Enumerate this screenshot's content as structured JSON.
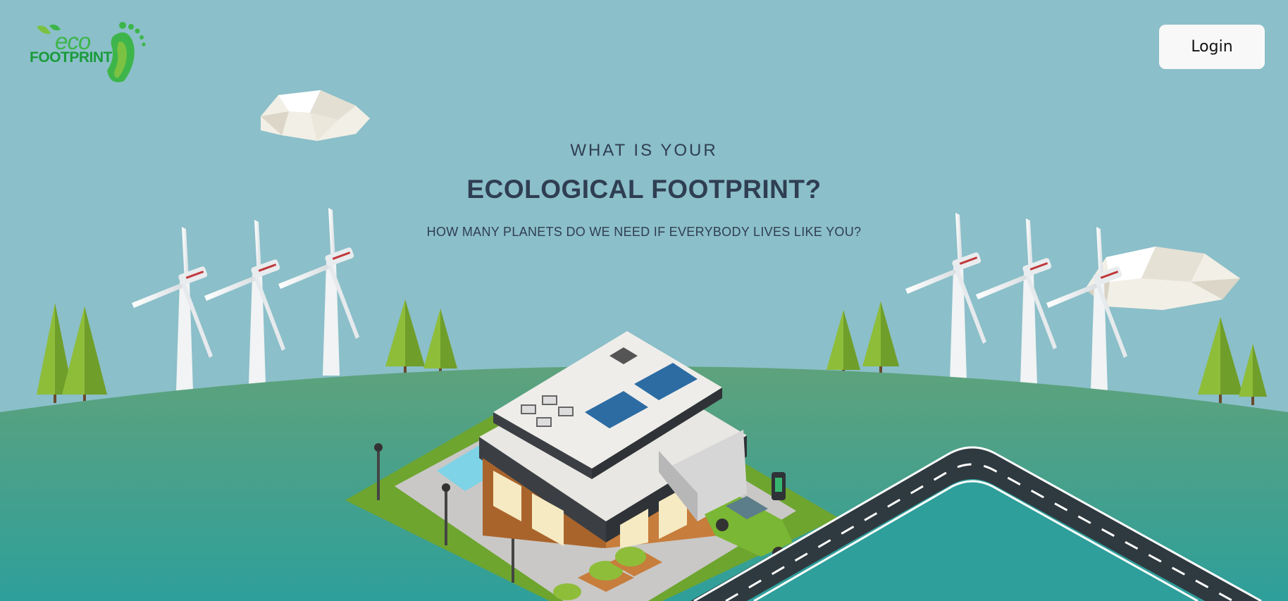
{
  "brand": {
    "logo_eco": "eco",
    "logo_footprint": "FOOTPRINT"
  },
  "header": {
    "login_label": "Login"
  },
  "hero": {
    "pretitle": "WHAT IS YOUR",
    "title": "ECOLOGICAL FOOTPRINT?",
    "subtitle": "HOW MANY PLANETS DO WE NEED IF EVERYBODY LIVES LIKE YOU?"
  },
  "colors": {
    "sky": "#8bbfc9",
    "ground_top": "#5ea27c",
    "ground_bottom": "#2e9f9b",
    "brand_green": "#3db54a",
    "text_dark": "#2f3e52"
  }
}
